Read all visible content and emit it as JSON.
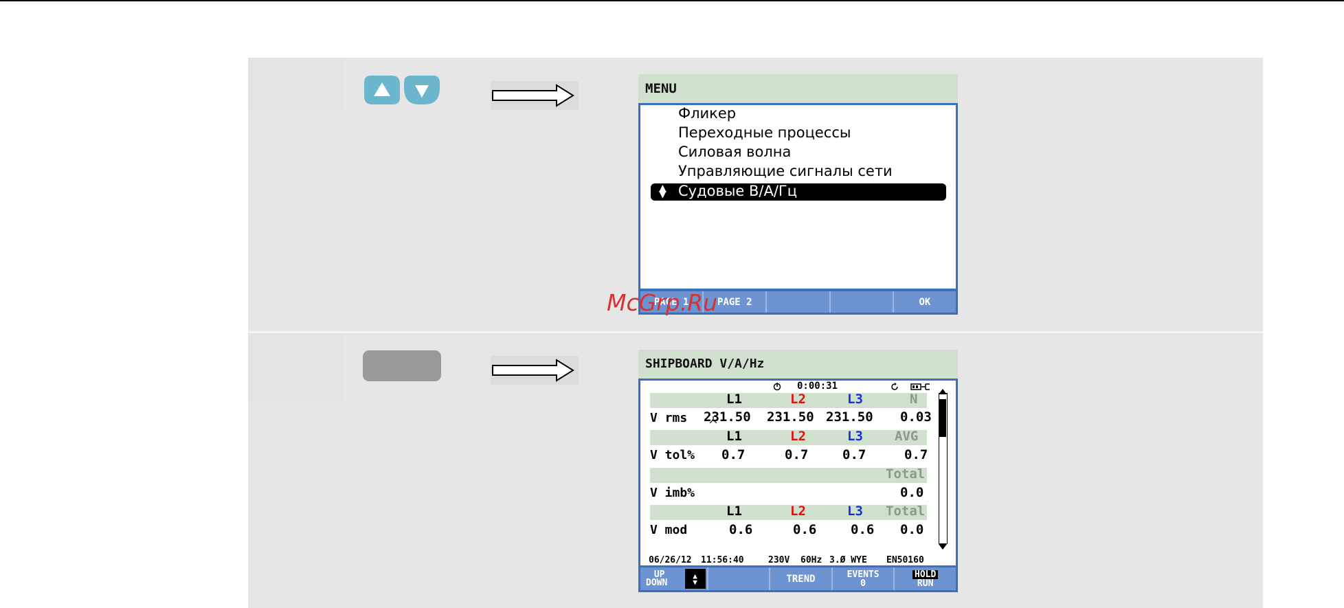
{
  "watermark": "McGrp.Ru",
  "step1": {
    "screen": {
      "title": "MENU",
      "items": [
        "Фликер",
        "Переходные процессы",
        "Силовая волна",
        "Управляющие сигналы сети"
      ],
      "selected": "Судовые В/А/Гц",
      "softkeys": [
        "PAGE 1",
        "PAGE 2",
        "",
        "",
        "OK"
      ]
    }
  },
  "step2": {
    "screen": {
      "title": "SHIPBOARD V/A/Hz",
      "timer": "0:00:31",
      "headers1": [
        "L1",
        "L2",
        "L3",
        "N"
      ],
      "vrms_label": "V rms",
      "vrms": [
        "231.50",
        "231.50",
        "231.50",
        "0.03"
      ],
      "headers2": [
        "L1",
        "L2",
        "L3",
        "AVG"
      ],
      "vtol_label": "V tol%",
      "vtol": [
        "0.7",
        "0.7",
        "0.7",
        "0.7"
      ],
      "headers3": [
        "Total"
      ],
      "vimb_label": "V imb%",
      "vimb": "0.0",
      "headers4": [
        "L1",
        "L2",
        "L3",
        "Total"
      ],
      "vmod_label": "V mod",
      "vmod": [
        "0.6",
        "0.6",
        "0.6",
        "0.0"
      ],
      "status": {
        "date": "06/26/12",
        "time": "11:56:40",
        "voltage": "230V",
        "freq": "60Hz",
        "config": "3.Ø WYE",
        "standard": "EN50160"
      },
      "softkeys": {
        "updown": [
          "UP",
          "DOWN"
        ],
        "trend": "TREND",
        "events": [
          "EVENTS",
          "0"
        ],
        "holdrun": [
          "HOLD",
          "RUN"
        ]
      }
    }
  },
  "colors": {
    "button_blue": "#6bb6cc",
    "button_gray": "#9a9a9a",
    "l2": "#e01010",
    "l3": "#1530d8"
  }
}
